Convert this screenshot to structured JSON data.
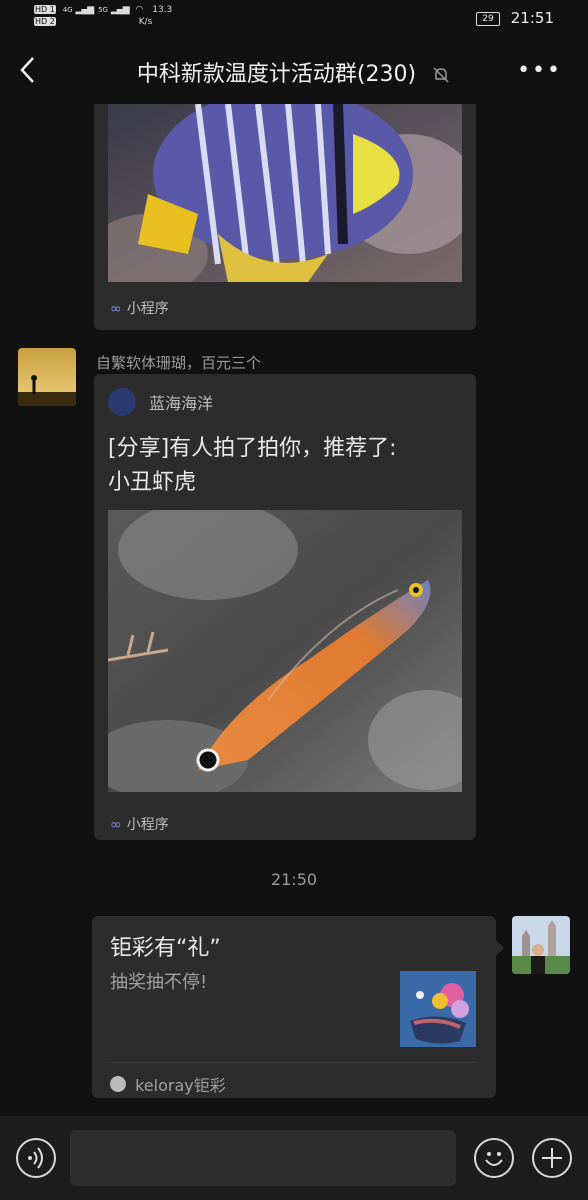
{
  "status_bar": {
    "sim1": "HD 1",
    "sim2": "HD 2",
    "net1": "4G",
    "net2": "5G",
    "speed": "13.3",
    "speed_unit": "K/s",
    "battery": "29",
    "time": "21:51"
  },
  "header": {
    "title": "中科新款温度计活动群(230)"
  },
  "messages": [
    {
      "type": "mini-program",
      "image_icon": "fish-image",
      "footer_label": "小程序"
    },
    {
      "type": "mini-program",
      "sender": "自繁软体珊瑚，百元三个",
      "source_name": "蓝海海洋",
      "title_line1": "[分享]有人拍了拍你，推荐了:",
      "title_line2": "小丑虾虎",
      "image_icon": "goby-fish-image",
      "footer_label": "小程序"
    },
    {
      "type": "timestamp",
      "text": "21:50"
    },
    {
      "type": "link-card",
      "title": "钜彩有“礼”",
      "subtitle": "抽奖抽不停!",
      "source_name": "keloray钜彩"
    }
  ],
  "colors": {
    "background": "#111111",
    "bubble": "#2c2c2c",
    "input_bar": "#1d1d1d",
    "mp_link": "#7a8fd6"
  }
}
